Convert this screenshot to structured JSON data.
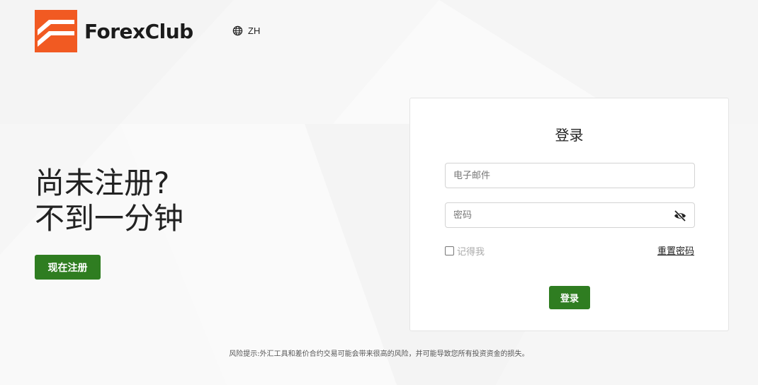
{
  "brand": {
    "name": "ForexClub",
    "logo_color": "#f15a22"
  },
  "header": {
    "language_label": "ZH",
    "language_icon": "globe-icon"
  },
  "promo": {
    "line1": "尚未注册?",
    "line2": "不到一分钟",
    "register_button": "现在注册"
  },
  "login": {
    "title": "登录",
    "email_placeholder": "电子邮件",
    "password_placeholder": "密码",
    "password_toggle_icon": "eye-slash-icon",
    "remember_label": "记得我",
    "reset_link": "重置密码",
    "submit_button": "登录"
  },
  "footer": {
    "risk_notice": "风险提示:外汇工具和差价合约交易可能会带来很高的风险，并可能导致您所有投资资金的损失。"
  },
  "colors": {
    "accent_green": "#2f7d21",
    "background": "#fafafa"
  }
}
